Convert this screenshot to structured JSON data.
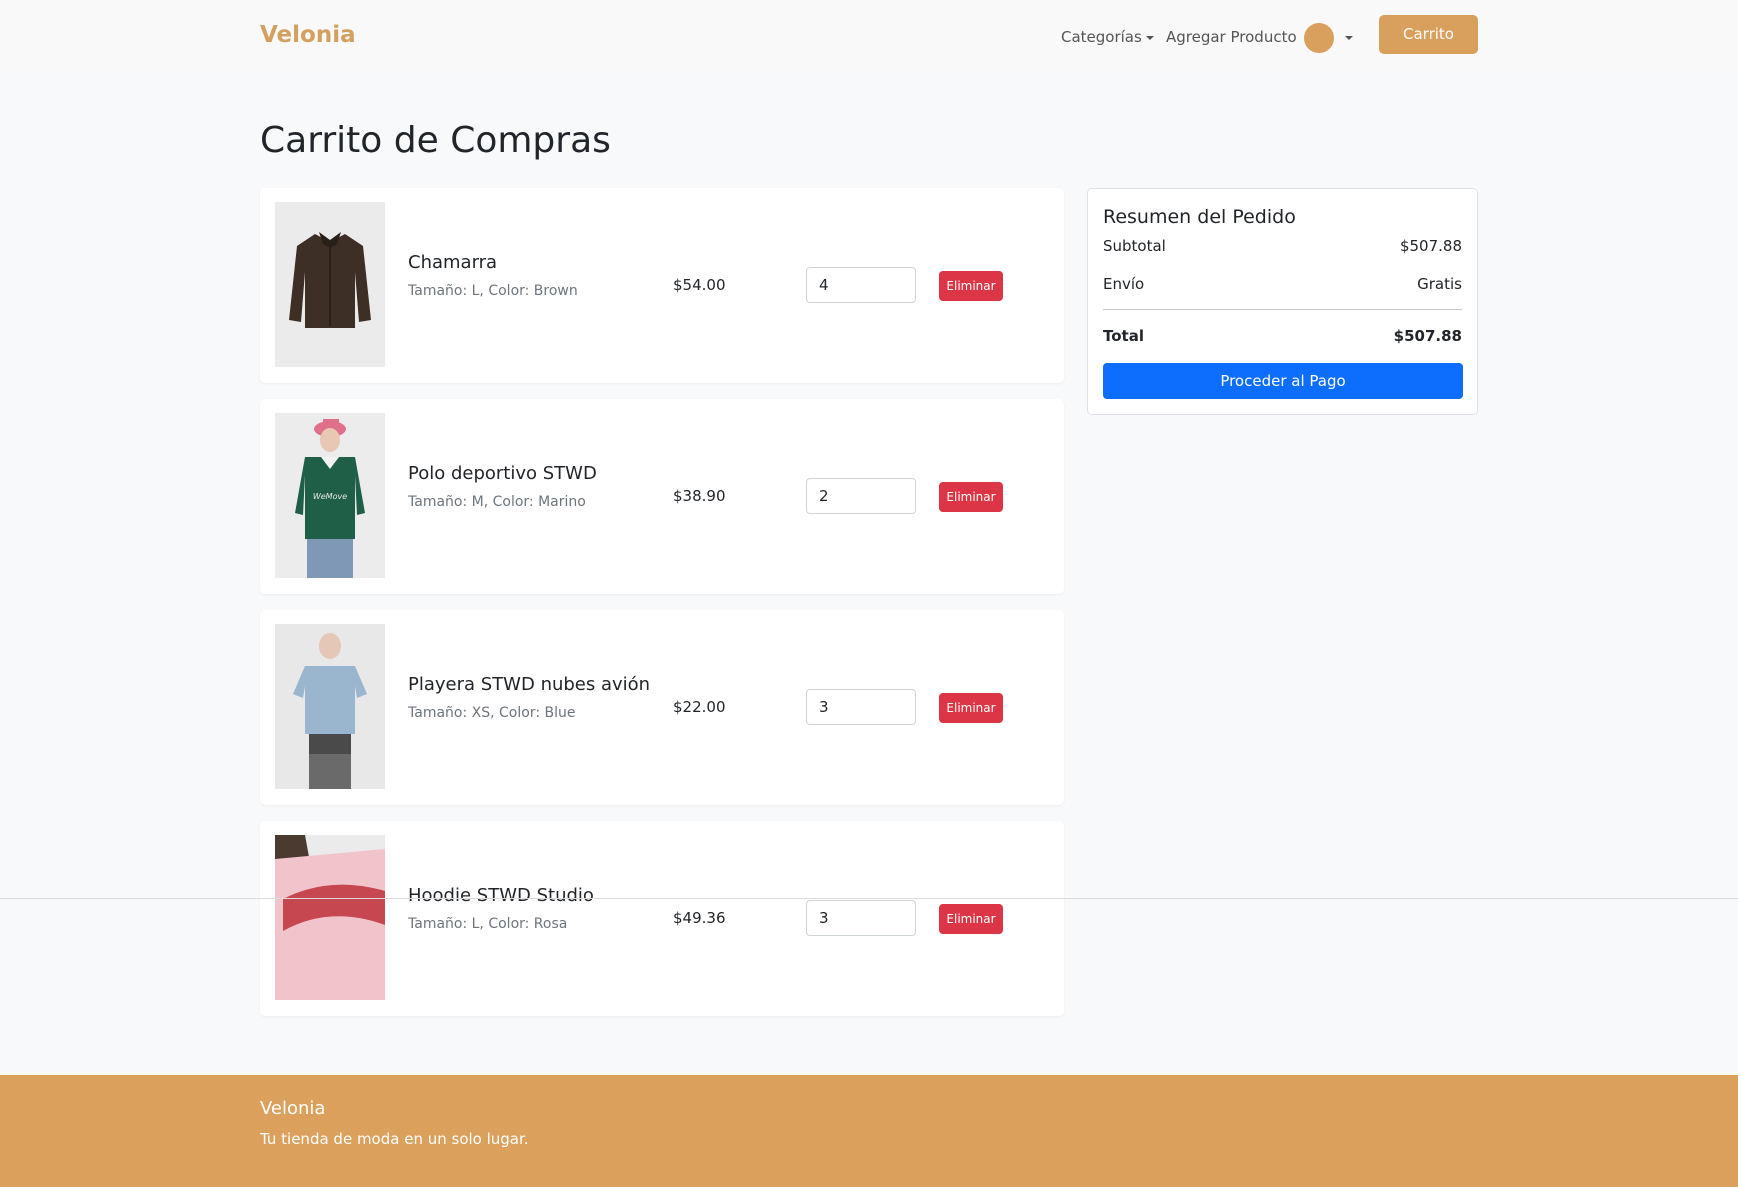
{
  "navbar": {
    "brand": "Velonia",
    "categories_label": "Categorías",
    "add_product_label": "Agregar Producto",
    "cart_label": "Carrito"
  },
  "page": {
    "title": "Carrito de Compras"
  },
  "cart": {
    "items": [
      {
        "name": "Chamarra",
        "meta": "Tamaño: L, Color: Brown",
        "price": "$54.00",
        "quantity": "4",
        "remove_label": "Eliminar",
        "image": "brown-leather-jacket"
      },
      {
        "name": "Polo deportivo STWD",
        "meta": "Tamaño: M, Color: Marino",
        "price": "$38.90",
        "quantity": "2",
        "remove_label": "Eliminar",
        "image": "person-green-polo-pink-cap"
      },
      {
        "name": "Playera STWD nubes avión",
        "meta": "Tamaño: XS, Color: Blue",
        "price": "$22.00",
        "quantity": "3",
        "remove_label": "Eliminar",
        "image": "person-blue-tshirt"
      },
      {
        "name": "Hoodie STWD Studio",
        "meta": "Tamaño: L, Color: Rosa",
        "price": "$49.36",
        "quantity": "3",
        "remove_label": "Eliminar",
        "image": "pink-hoodie-back-print"
      }
    ]
  },
  "summary": {
    "title": "Resumen del Pedido",
    "subtotal_label": "Subtotal",
    "subtotal_value": "$507.88",
    "shipping_label": "Envío",
    "shipping_value": "Gratis",
    "total_label": "Total",
    "total_value": "$507.88",
    "checkout_label": "Proceder al Pago"
  },
  "footer": {
    "brand": "Velonia",
    "tagline": "Tu tienda de moda en un solo lugar."
  },
  "colors": {
    "brand": "#d4a060",
    "accent": "#d99f5c",
    "danger": "#dc3545",
    "primary": "#0d6efd",
    "footer": "#dba05c"
  }
}
